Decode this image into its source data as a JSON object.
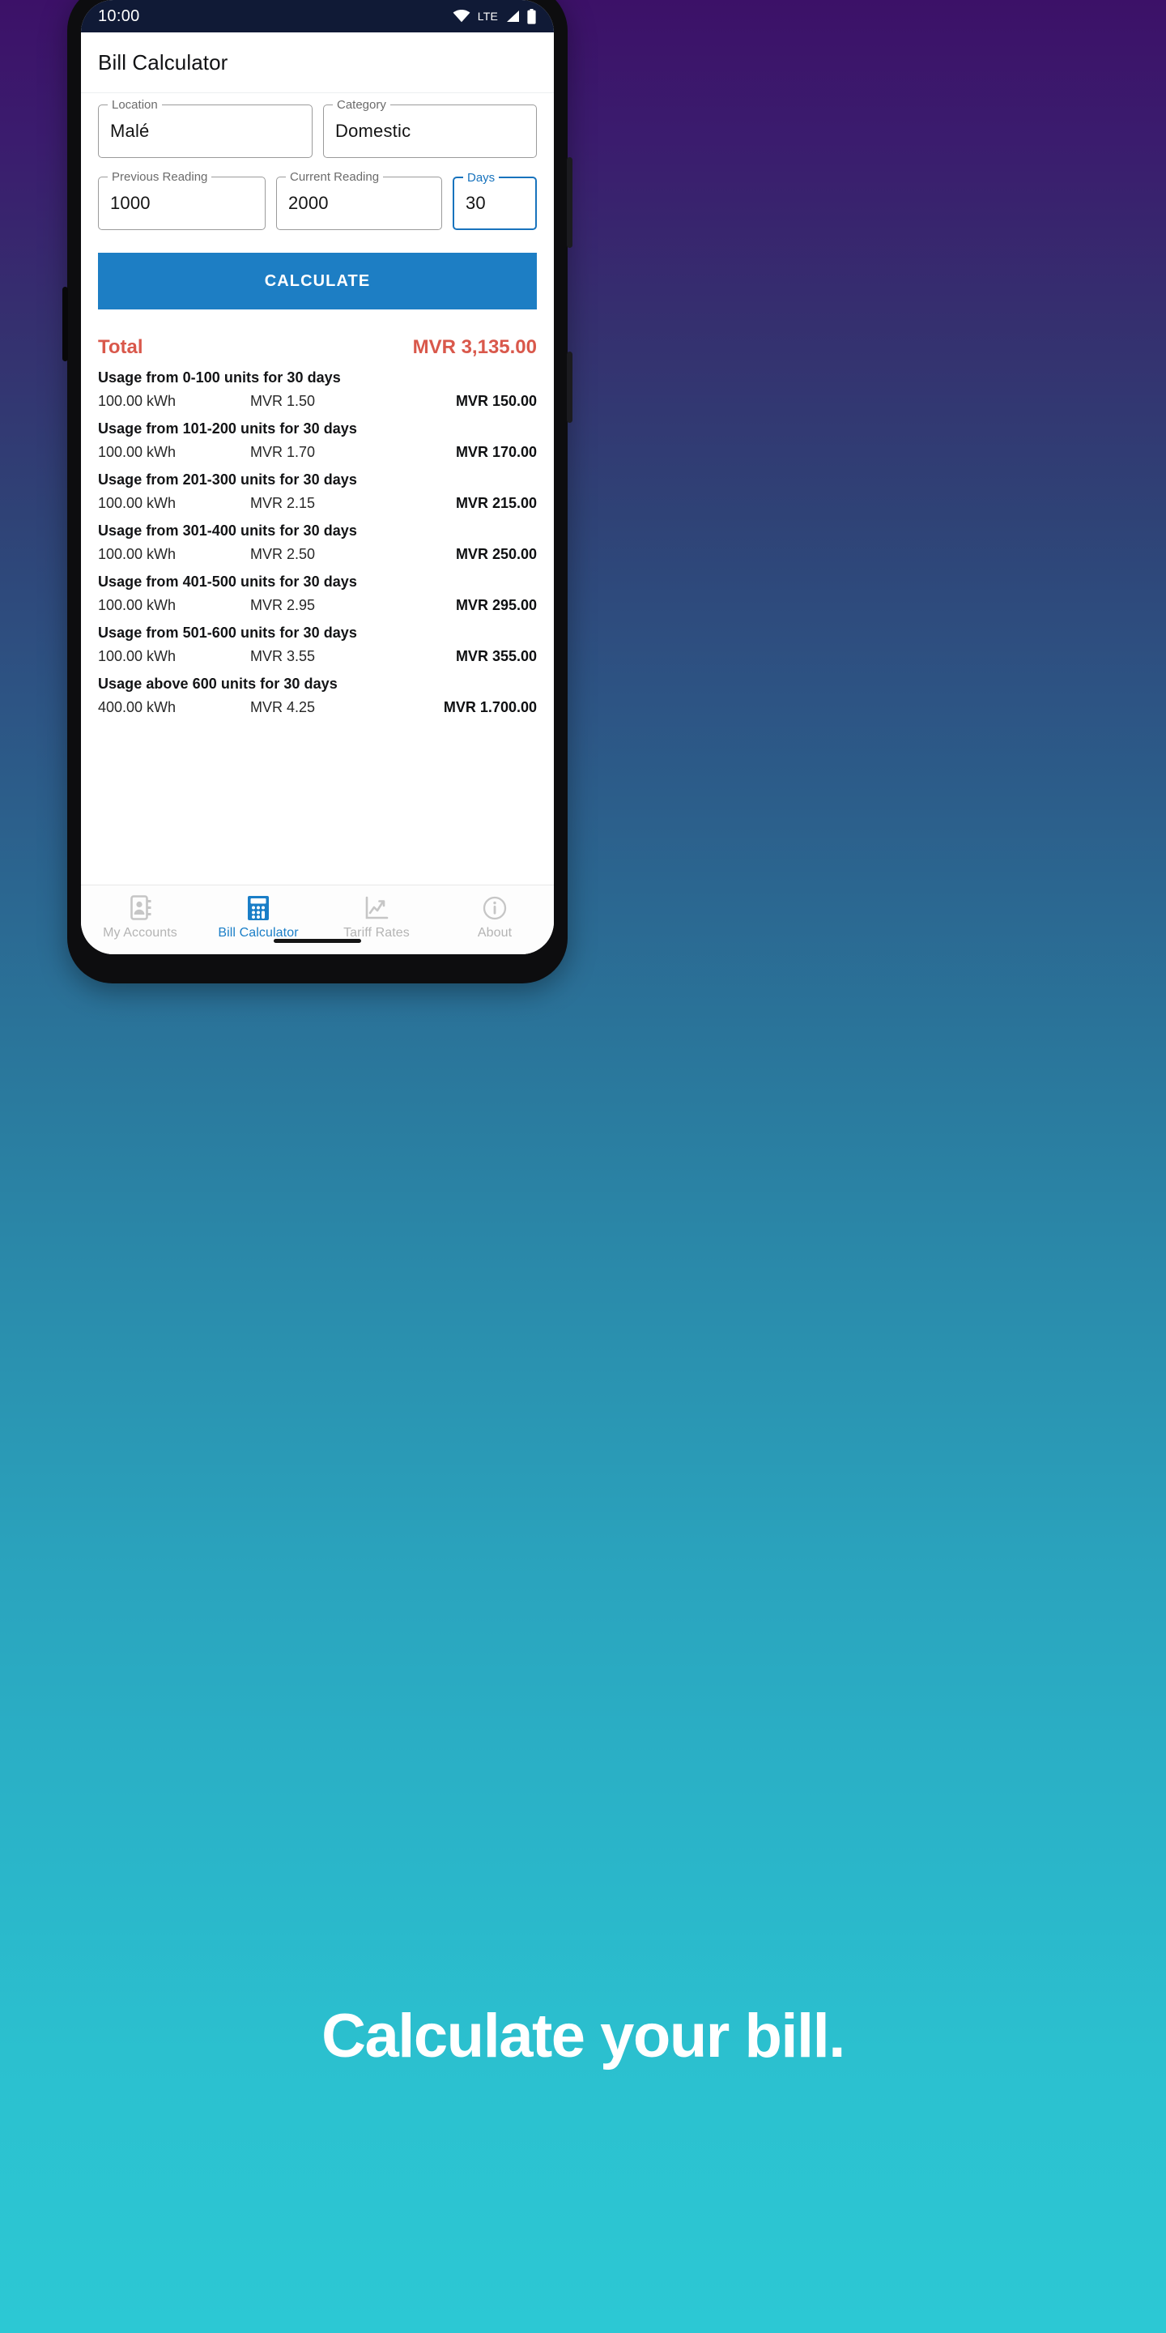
{
  "status_bar": {
    "time": "10:00",
    "network_label": "LTE",
    "icons": [
      "wifi-icon",
      "lte-label",
      "signal-icon",
      "battery-icon"
    ]
  },
  "app_bar": {
    "title": "Bill Calculator"
  },
  "form": {
    "location": {
      "label": "Location",
      "value": "Malé"
    },
    "category": {
      "label": "Category",
      "value": "Domestic"
    },
    "previous_reading": {
      "label": "Previous Reading",
      "value": "1000"
    },
    "current_reading": {
      "label": "Current Reading",
      "value": "2000"
    },
    "days": {
      "label": "Days",
      "value": "30",
      "focused": true
    }
  },
  "calculate_button": {
    "label": "CALCULATE"
  },
  "results": {
    "total_label": "Total",
    "total_value": "MVR 3,135.00",
    "total_color": "#d9584b",
    "rows": [
      {
        "title": "Usage from 0-100 units for 30 days",
        "kwh": "100.00 kWh",
        "rate": "MVR 1.50",
        "amount": "MVR 150.00"
      },
      {
        "title": "Usage from 101-200 units for 30 days",
        "kwh": "100.00 kWh",
        "rate": "MVR 1.70",
        "amount": "MVR 170.00"
      },
      {
        "title": "Usage from 201-300 units for 30 days",
        "kwh": "100.00 kWh",
        "rate": "MVR 2.15",
        "amount": "MVR 215.00"
      },
      {
        "title": "Usage from 301-400 units for 30 days",
        "kwh": "100.00 kWh",
        "rate": "MVR 2.50",
        "amount": "MVR 250.00"
      },
      {
        "title": "Usage from 401-500 units for 30 days",
        "kwh": "100.00 kWh",
        "rate": "MVR 2.95",
        "amount": "MVR 295.00"
      },
      {
        "title": "Usage from 501-600 units for 30 days",
        "kwh": "100.00 kWh",
        "rate": "MVR 3.55",
        "amount": "MVR 355.00"
      },
      {
        "title": "Usage above 600 units for 30 days",
        "kwh": "400.00 kWh",
        "rate": "MVR 4.25",
        "amount": "MVR 1.700.00"
      }
    ]
  },
  "bottom_nav": {
    "active_color": "#1a7ec7",
    "inactive_color": "#b4b4b4",
    "items": [
      {
        "label": "My Accounts",
        "icon": "contact-card-icon",
        "active": false
      },
      {
        "label": "Bill Calculator",
        "icon": "calculator-icon",
        "active": true
      },
      {
        "label": "Tariff Rates",
        "icon": "chart-trend-icon",
        "active": false
      },
      {
        "label": "About",
        "icon": "info-circle-icon",
        "active": false
      }
    ]
  },
  "tagline": {
    "text": "Calculate your bill."
  }
}
